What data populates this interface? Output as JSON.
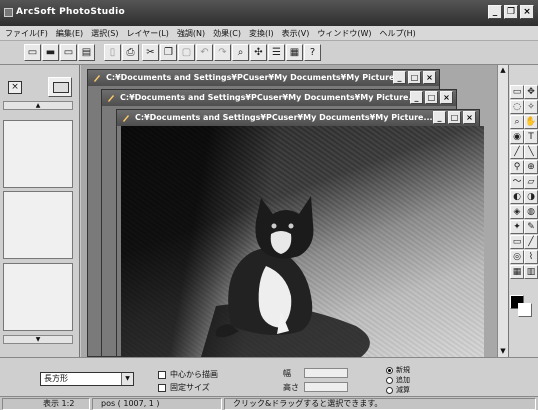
{
  "app": {
    "title": "ArcSoft PhotoStudio"
  },
  "menu": [
    "ファイル(F)",
    "編集(E)",
    "選択(S)",
    "レイヤー(L)",
    "強調(N)",
    "効果(C)",
    "変換(I)",
    "表示(V)",
    "ウィンドウ(W)",
    "ヘルプ(H)"
  ],
  "documents": [
    {
      "title": "C:¥Documents and Settings¥PCuser¥My Documents¥My Picture..."
    },
    {
      "title": "C:¥Documents and Settings¥PCuser¥My Documents¥My Picture..."
    },
    {
      "title": "C:¥Documents and Settings¥PCuser¥My Documents¥My Picture..."
    }
  ],
  "options": {
    "shape_value": "長方形",
    "draw_from_center": "中心から描画",
    "fixed_size": "固定サイズ",
    "width_label": "幅",
    "height_label": "高さ",
    "mode_new": "新規",
    "mode_add": "追加",
    "mode_subtract": "減算"
  },
  "status": {
    "zoom": "表示 1:2",
    "position": "pos ( 1007, 1 )",
    "message": "クリック&ドラッグすると選択できます。"
  }
}
